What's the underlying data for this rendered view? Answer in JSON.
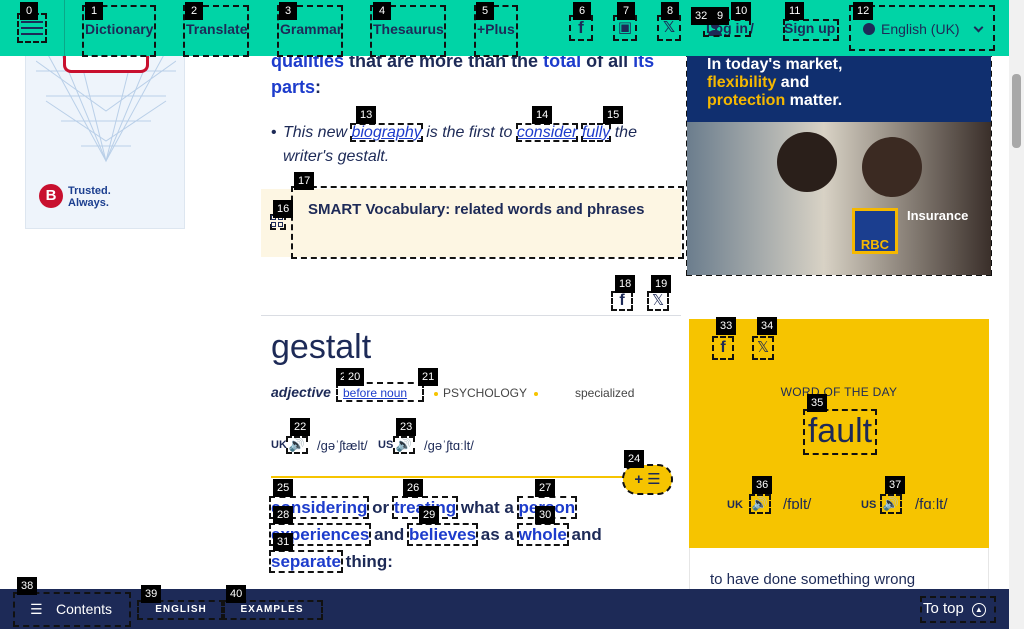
{
  "header": {
    "nav": [
      "Dictionary",
      "Translate",
      "Grammar",
      "Thesaurus",
      "+Plus"
    ],
    "social_icons": [
      "f",
      "▣",
      "𝕏"
    ],
    "login_label": "Log in",
    "separator": "/",
    "signup_label": "Sign up",
    "language_label": "English (UK)",
    "user_icon": "user-icon",
    "globe_icon": "globe-icon"
  },
  "left_ad": {
    "logo_letter": "B",
    "tagline_1": "Trusted.",
    "tagline_2": "Always."
  },
  "intro": {
    "link_1": "qualities",
    "text_1": " that are more than the ",
    "link_2": "total",
    "text_2": " of all ",
    "link_3": "its",
    "line_2_link": "parts",
    "line_2_tail": ":"
  },
  "example": {
    "bullet": "•",
    "text_1": "This new ",
    "link_1": "biography",
    "text_2": " is the first to ",
    "link_2": "consider",
    "link_3": "fully",
    "text_3": " the writer's gestalt."
  },
  "smart_vocab": {
    "label": "SMART Vocabulary: related words and phrases"
  },
  "share": {
    "fb": "f",
    "x": "𝕏"
  },
  "entry": {
    "headword": "gestalt",
    "pos": "adjective",
    "grammar": "before noun",
    "label_1": "PSYCHOLOGY",
    "label_2": "specialized",
    "uk_region": "UK",
    "uk_ipa": "/ɡəˈʃtælt/",
    "us_region": "US",
    "us_ipa": "/ɡəˈʃtɑːlt/",
    "speaker": "🔊",
    "add_button": "+ ☰"
  },
  "definition": {
    "link_1": "considering",
    "text_1": " or ",
    "link_2": "treating",
    "text_2": " what a ",
    "link_3": "person",
    "text_3": " ",
    "link_4": "experiences",
    "text_4": " and ",
    "link_5": "believes",
    "text_5": " as a ",
    "link_6": "whole",
    "text_6": " and ",
    "link_7": "separate",
    "text_7": " thing:"
  },
  "right_ad": {
    "headline_1": "In today's market,",
    "headline_2": "flexibility",
    "headline_3": " and",
    "headline_4": "protection",
    "headline_5": " matter.",
    "brand": "RBC",
    "product": "Insurance"
  },
  "wotd": {
    "fb": "f",
    "x": "𝕏",
    "title": "WORD OF THE DAY",
    "word": "fault",
    "uk_region": "UK",
    "uk_ipa": "/fɒlt/",
    "us_region": "US",
    "us_ipa": "/fɑːlt/",
    "definition": "to have done something wrong"
  },
  "bottom": {
    "contents_icon": "☰",
    "contents_label": "Contents",
    "tab_english": "ENGLISH",
    "tab_examples": "EXAMPLES",
    "totop_label": "To top",
    "totop_icon": "▲"
  },
  "tags": [
    "0",
    "1",
    "2",
    "3",
    "4",
    "5",
    "6",
    "7",
    "8",
    "9",
    "10",
    "11",
    "12",
    "13",
    "14",
    "15",
    "16",
    "17",
    "18",
    "19",
    "20",
    "20",
    "21",
    "22",
    "23",
    "24",
    "25",
    "26",
    "27",
    "28",
    "29",
    "30",
    "31",
    "32",
    "33",
    "34",
    "35",
    "36",
    "37",
    "38",
    "39",
    "40"
  ]
}
